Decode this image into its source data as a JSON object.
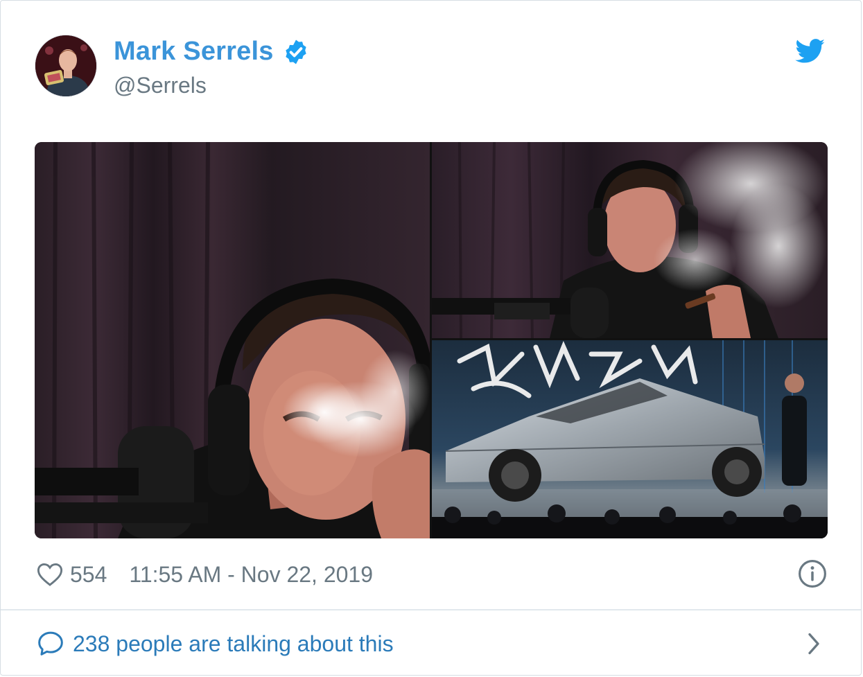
{
  "tweet": {
    "author": {
      "name": "Mark Serrels",
      "handle": "@Serrels",
      "verified": true,
      "verified_icon": "verified-badge-icon"
    },
    "brand_icon": "twitter-bird-icon",
    "media": {
      "count": 3,
      "photos": [
        "photo-smoking-podcast",
        "photo-podcast-cigar",
        "photo-cybertruck-reveal"
      ]
    },
    "footer": {
      "like_icon": "heart-icon",
      "like_count": "554",
      "timestamp": "11:55 AM - Nov 22, 2019",
      "info_icon": "info-icon"
    },
    "conversation": {
      "icon": "comment-bubble-icon",
      "text": "238 people are talking about this",
      "chevron_icon": "chevron-right-icon"
    }
  },
  "colors": {
    "link": "#3b94d9",
    "secondary_text": "#697882",
    "conversation_link": "#2b7bb9",
    "twitter_blue": "#1da1f2",
    "border": "#e1e8ed"
  }
}
